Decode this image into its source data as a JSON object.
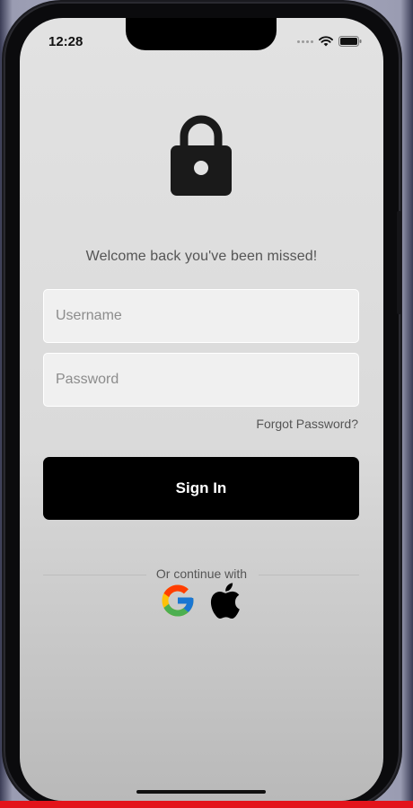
{
  "status_bar": {
    "time": "12:28",
    "icons": [
      "signal-dots-icon",
      "wifi-icon",
      "battery-icon"
    ]
  },
  "hero": {
    "icon": "lock-icon",
    "welcome_text": "Welcome back you've been missed!"
  },
  "form": {
    "username_placeholder": "Username",
    "password_placeholder": "Password",
    "forgot_password": "Forgot Password?",
    "sign_in_label": "Sign In"
  },
  "social": {
    "divider_text": "Or continue with",
    "providers": [
      "google-icon",
      "apple-icon"
    ]
  },
  "colors": {
    "primary_button": "#000000",
    "google_blue": "#4285F4",
    "google_red": "#EA4335",
    "google_yellow": "#FBBC05",
    "google_green": "#34A853",
    "video_progress": "#e3141b"
  }
}
